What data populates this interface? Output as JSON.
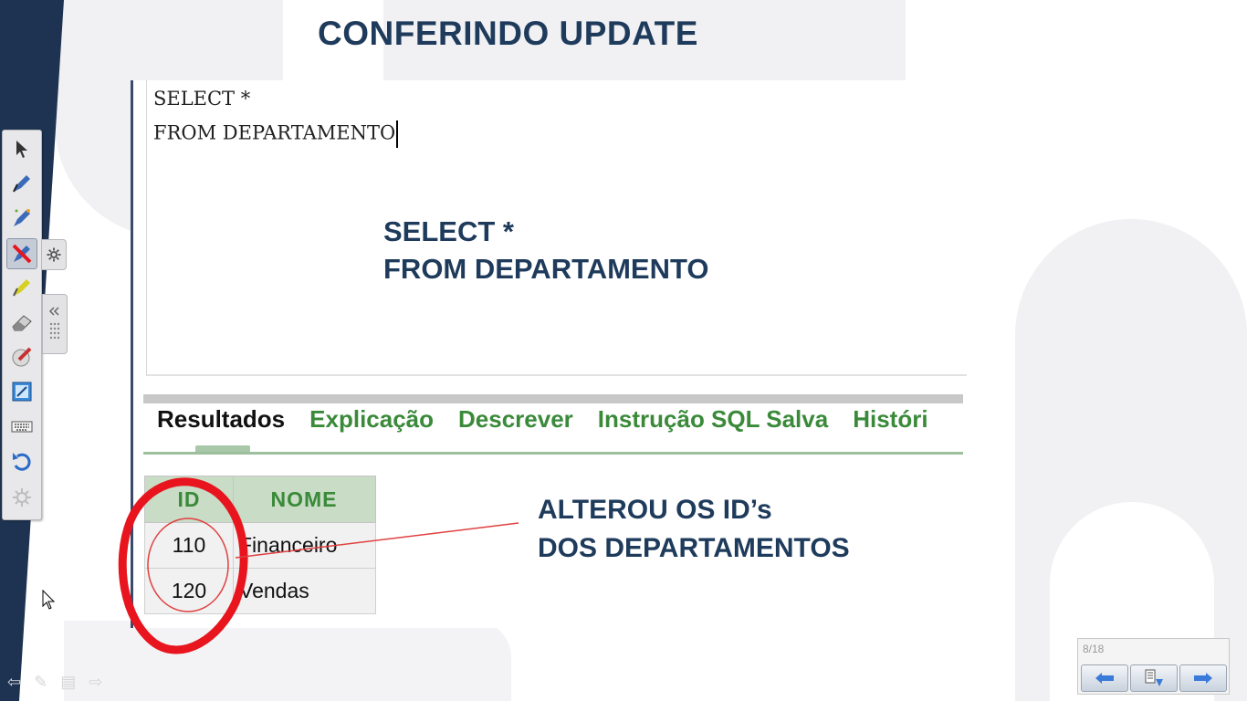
{
  "slide": {
    "title": "CONFERINDO UPDATE"
  },
  "sql_editor": {
    "line1": "SELECT *",
    "line2": "FROM DEPARTAMENTO"
  },
  "query_overlay": {
    "line1": "SELECT *",
    "line2": "FROM DEPARTAMENTO"
  },
  "result_tabs": [
    {
      "label": "Resultados",
      "active": true
    },
    {
      "label": "Explicação",
      "active": false
    },
    {
      "label": "Descrever",
      "active": false
    },
    {
      "label": "Instrução SQL Salva",
      "active": false
    },
    {
      "label": "Históri",
      "active": false
    }
  ],
  "results_table": {
    "headers": [
      "ID",
      "NOME"
    ],
    "rows": [
      [
        "110",
        "Financeiro"
      ],
      [
        "120",
        "Vendas"
      ]
    ]
  },
  "annotation": {
    "line1": "ALTEROU OS ID’s",
    "line2": "DOS DEPARTAMENTOS",
    "ink_color": "#e8141e"
  },
  "pen_toolbar": {
    "tools": [
      "select-arrow-icon",
      "pen-icon",
      "creative-pen-icon",
      "highlighter-pen-icon",
      "highlighter-icon",
      "eraser-icon",
      "magic-pen-icon",
      "screen-capture-icon",
      "keyboard-icon",
      "undo-icon",
      "settings-icon"
    ]
  },
  "slide_nav": {
    "page_indicator": "8/18"
  },
  "colors": {
    "title": "#1f3b5c",
    "tab_green": "#3a8a3a",
    "header_bg": "#c9dcc6",
    "dark_stripe": "#1e3352"
  }
}
